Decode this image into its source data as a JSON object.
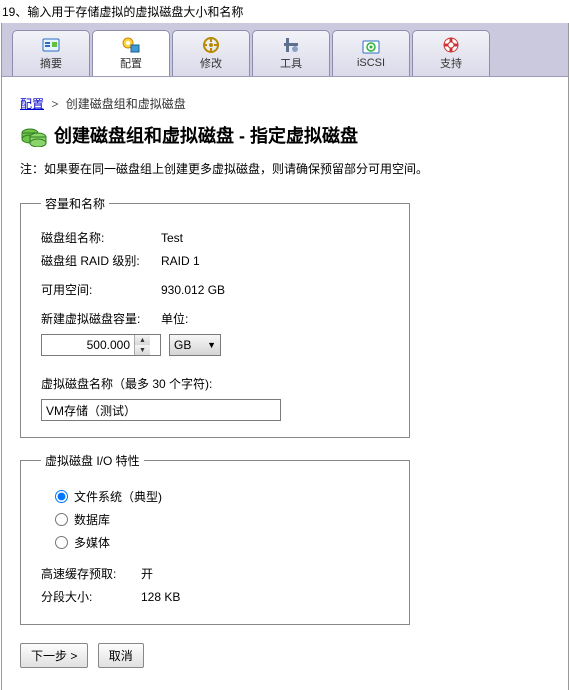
{
  "instruction": "19、输入用于存储虚拟的虚拟磁盘大小和名称",
  "toolbar": [
    {
      "key": "summary",
      "label": "摘要",
      "active": false
    },
    {
      "key": "configure",
      "label": "配置",
      "active": true
    },
    {
      "key": "modify",
      "label": "修改",
      "active": false
    },
    {
      "key": "tools",
      "label": "工具",
      "active": false
    },
    {
      "key": "iscsi",
      "label": "iSCSI",
      "active": false
    },
    {
      "key": "support",
      "label": "支持",
      "active": false
    }
  ],
  "breadcrumb": {
    "root": "配置",
    "current": "创建磁盘组和虚拟磁盘"
  },
  "page_title": "创建磁盘组和虚拟磁盘 - 指定虚拟磁盘",
  "note": "注：如果要在同一磁盘组上创建更多虚拟磁盘，则请确保预留部分可用空间。",
  "capacity_group": {
    "legend": "容量和名称",
    "dg_name_label": "磁盘组名称:",
    "dg_name_value": "Test",
    "raid_label": "磁盘组 RAID 级别:",
    "raid_value": "RAID 1",
    "free_label": "可用空间:",
    "free_value": "930.012 GB",
    "new_cap_label": "新建虚拟磁盘容量:",
    "unit_label": "单位:",
    "new_cap_value": "500.000",
    "unit_value": "GB",
    "vd_name_label": "虚拟磁盘名称（最多 30 个字符):",
    "vd_name_value": "VM存储（测试）"
  },
  "io_group": {
    "legend": "虚拟磁盘 I/O 特性",
    "options": [
      {
        "key": "fs",
        "label": "文件系统（典型)",
        "checked": true
      },
      {
        "key": "db",
        "label": "数据库",
        "checked": false
      },
      {
        "key": "mm",
        "label": "多媒体",
        "checked": false
      }
    ],
    "cache_label": "高速缓存预取:",
    "cache_value": "开",
    "seg_label": "分段大小:",
    "seg_value": "128 KB"
  },
  "nav": {
    "next": "下一步 >",
    "cancel": "取消"
  }
}
